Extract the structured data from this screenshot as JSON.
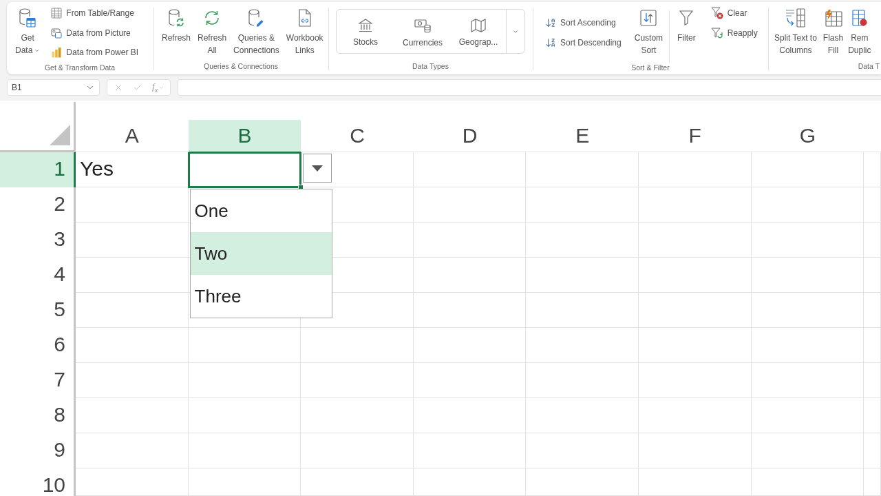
{
  "ribbon": {
    "groups": [
      {
        "label": "Get & Transform Data",
        "controls": [
          {
            "kind": "large",
            "lines": [
              "Get",
              "Data"
            ],
            "menu": true
          },
          {
            "kind": "stack",
            "items": [
              "From Table/Range",
              "Data from Picture",
              "Data from Power BI"
            ]
          }
        ]
      },
      {
        "label": "Queries & Connections",
        "controls": [
          {
            "kind": "large",
            "lines": [
              "Refresh"
            ],
            "menu": false
          },
          {
            "kind": "large",
            "lines": [
              "Refresh",
              "All"
            ],
            "menu": false
          },
          {
            "kind": "large",
            "lines": [
              "Queries &",
              "Connections"
            ],
            "menu": false
          },
          {
            "kind": "large",
            "lines": [
              "Workbook",
              "Links"
            ],
            "menu": false
          }
        ]
      },
      {
        "label": "Data Types",
        "controls": [
          {
            "kind": "gallery",
            "items": [
              "Stocks",
              "Currencies",
              "Geograp..."
            ]
          }
        ]
      },
      {
        "label": "Sort & Filter",
        "controls": [
          {
            "kind": "stack",
            "items": [
              "Sort Ascending",
              "Sort Descending"
            ]
          },
          {
            "kind": "large",
            "lines": [
              "Custom",
              "Sort"
            ],
            "menu": false
          },
          {
            "kind": "large",
            "lines": [
              "Filter"
            ],
            "menu": false
          },
          {
            "kind": "stack",
            "items": [
              "Clear",
              "Reapply"
            ]
          }
        ]
      },
      {
        "label": "Data T",
        "controls": [
          {
            "kind": "large",
            "lines": [
              "Split Text to",
              "Columns"
            ],
            "menu": false
          },
          {
            "kind": "large",
            "lines": [
              "Flash",
              "Fill"
            ],
            "menu": false
          },
          {
            "kind": "large",
            "lines": [
              "Rem",
              "Duplic"
            ],
            "menu": false
          }
        ]
      }
    ]
  },
  "formula_bar": {
    "name_box": "B1",
    "function_label": "f$_{x}$"
  },
  "sheet": {
    "columns": [
      {
        "label": "A",
        "selected": false
      },
      {
        "label": "B",
        "selected": true
      },
      {
        "label": "C",
        "selected": false
      },
      {
        "label": "D",
        "selected": false
      },
      {
        "label": "E",
        "selected": false
      },
      {
        "label": "F",
        "selected": false
      },
      {
        "label": "G",
        "selected": false
      }
    ],
    "rows": [
      {
        "label": "1",
        "selected": true,
        "cells": [
          {
            "value": "Yes",
            "selected": false
          },
          {
            "selected": true,
            "dropdown": {
              "options": [
                {
                  "label": "One",
                  "selected": false
                },
                {
                  "label": "Two",
                  "selected": true
                },
                {
                  "label": "Three",
                  "selected": false
                }
              ]
            }
          }
        ]
      },
      {
        "label": "2",
        "selected": false
      },
      {
        "label": "3",
        "selected": false
      },
      {
        "label": "4",
        "selected": false
      },
      {
        "label": "5",
        "selected": false
      },
      {
        "label": "6",
        "selected": false
      },
      {
        "label": "7",
        "selected": false
      },
      {
        "label": "8",
        "selected": false
      },
      {
        "label": "9",
        "selected": false
      },
      {
        "label": "10",
        "selected": false
      }
    ]
  }
}
